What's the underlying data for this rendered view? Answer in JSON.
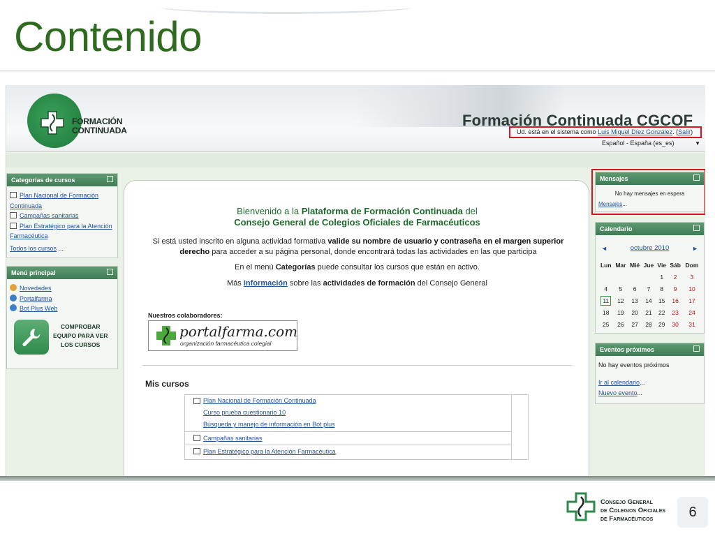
{
  "slide": {
    "title": "Contenido",
    "page_number": "6",
    "footer_org": [
      "Consejo General",
      "de Colegios Oficiales",
      "de Farmacéuticos"
    ]
  },
  "header": {
    "logo_text": [
      "FORMACIÓN",
      "CONTINUADA"
    ],
    "site_title": "Formación Continuada CGCOF",
    "login_prefix": "Ud. está en el sistema como ",
    "user_name": "Luis Miguel Díez Gonzalez",
    "login_sep": ". (",
    "logout": "Salir",
    "login_suffix": ")",
    "language": "Español - España (es_es)"
  },
  "categorias": {
    "title": "Categorías de cursos",
    "items": [
      "Plan Nacional de Formación Continuada",
      "Campañas sanitarias",
      "Plan Estratégico para la Atención Farmacéutica"
    ],
    "all_courses": "Todos los cursos",
    "all_courses_suffix": " ..."
  },
  "menu_principal": {
    "title": "Menú principal",
    "items": [
      "Novedades",
      "Portalfarma",
      "Bot Plus Web"
    ],
    "check_button": [
      "COMPROBAR",
      "EQUIPO PARA VER",
      "LOS CURSOS"
    ]
  },
  "mensajes": {
    "title": "Mensajes",
    "empty": "No hay mensajes en espera",
    "link": "Mensajes",
    "link_suffix": "..."
  },
  "calendario": {
    "title": "Calendario",
    "month": "octubre 2010",
    "prev": "◄",
    "next": "►",
    "weekdays": [
      "Lun",
      "Mar",
      "Mié",
      "Jue",
      "Vie",
      "Sáb",
      "Dom"
    ],
    "weeks": [
      [
        "",
        "",
        "",
        "",
        "1",
        "2",
        "3"
      ],
      [
        "4",
        "5",
        "6",
        "7",
        "8",
        "9",
        "10"
      ],
      [
        "11",
        "12",
        "13",
        "14",
        "15",
        "16",
        "17"
      ],
      [
        "18",
        "19",
        "20",
        "21",
        "22",
        "23",
        "24"
      ],
      [
        "25",
        "26",
        "27",
        "28",
        "29",
        "30",
        "31"
      ]
    ],
    "today": "11"
  },
  "eventos": {
    "title": "Eventos próximos",
    "empty": "No hay eventos próximos",
    "link_calendar": "Ir al calendario",
    "link_new": "Nuevo evento",
    "ellipsis": "..."
  },
  "main": {
    "welcome_1_pre": "Bienvenido a la ",
    "welcome_1_bold": "Plataforma de Formación Continuada",
    "welcome_1_post": " del",
    "welcome_2": "Consejo General de Colegios Oficiales de Farmacéuticos",
    "intro_pre": "Si está usted inscrito en alguna actividad formativa ",
    "intro_bold1": "valide su nombre de usuario y contraseña en el margen superior derecho",
    "intro_post": " para acceder a su página personal, donde encontrará todas las actividades en las que participa",
    "para2_pre": "En el menú ",
    "para2_bold": "Categorías",
    "para2_post": " puede consultar los cursos que están en activo.",
    "para3_pre": "Más ",
    "para3_link": "información",
    "para3_mid": " sobre las ",
    "para3_bold": "actividades de formación",
    "para3_post": " del Consejo General",
    "collaborators_label": "Nuestros colaboradores:",
    "portalfarma_word": "portalfarma.com",
    "portalfarma_sub": "organización farmacéutica colegial",
    "mis_cursos_title": "Mis cursos",
    "courses": [
      "Plan Nacional de Formación Continuada",
      "Curso prueba cuestionario 10",
      "Búsqueda y manejo de información en Bot plus",
      "Campañas sanitarias",
      "Plan Estratégico para la Atención Farmacéutica"
    ]
  },
  "colors": {
    "accent_green": "#2f6b1f",
    "block_header": "#3f7b54",
    "link_blue": "#23569e",
    "highlight_red": "#d8141c"
  }
}
